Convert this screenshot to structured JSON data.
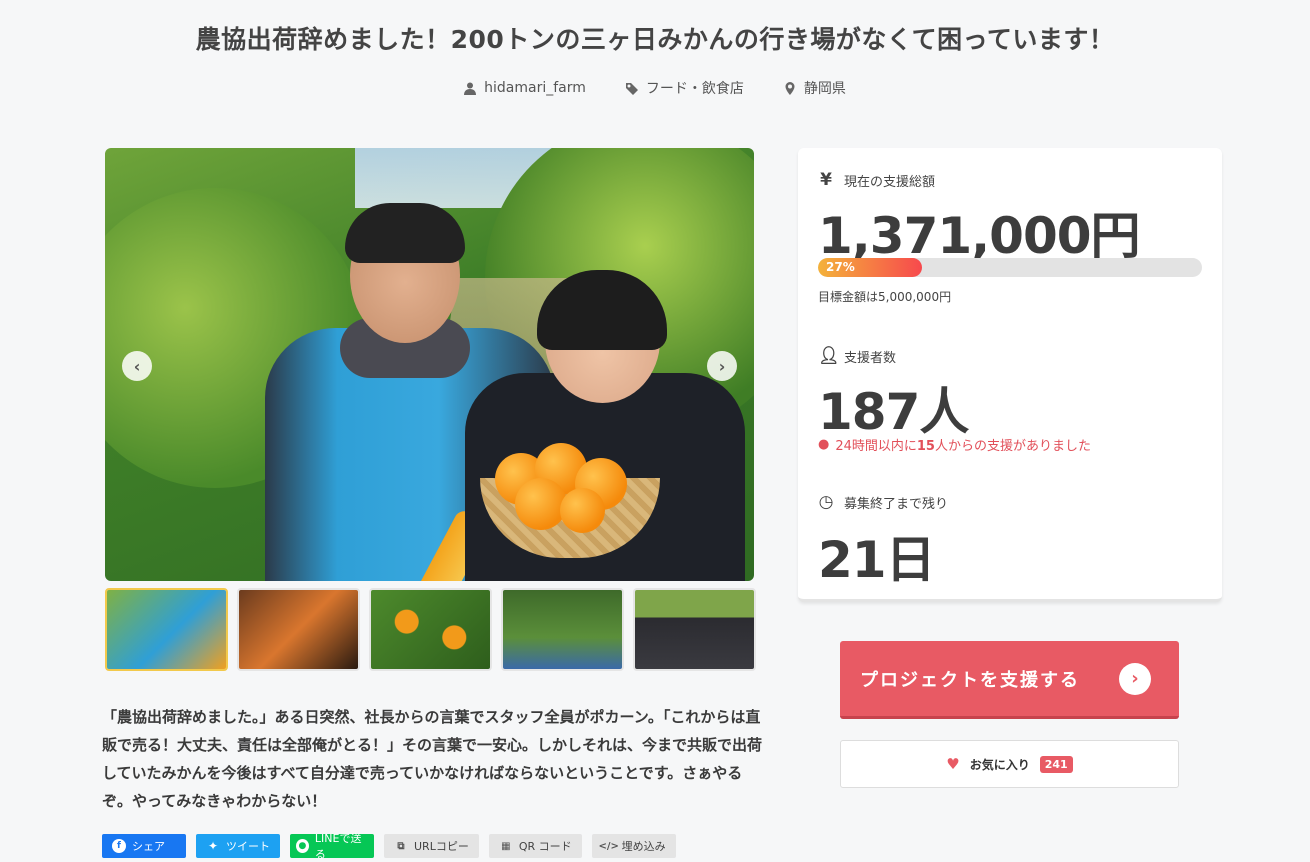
{
  "title": "農協出荷辞めました！200トンの三ヶ日みかんの行き場がなくて困っています！",
  "meta": {
    "author": "hidamari_farm",
    "category": "フード・飲食店",
    "location": "静岡県",
    "icons": [
      "user-icon",
      "tag-icon",
      "map-pin-icon"
    ]
  },
  "gallery": {
    "prev": "‹",
    "next": "›",
    "thumbnail_count": 5,
    "active_index": 0
  },
  "description": "「農協出荷辞めました。」ある日突然、社長からの言葉でスタッフ全員がポカーン。「これからは直販で売る！大丈夫、責任は全部俺がとる！」その言葉で一安心。しかしそれは、今まで共販で出荷していたみかんを今後はすべて自分達で売っていかなければならないということです。さぁやるぞ。やってみなきゃわからない！",
  "share": {
    "facebook": "シェア",
    "twitter": "ツイート",
    "line": "LINEで送る",
    "url": "URLコピー",
    "qr": "QR コード",
    "embed": "埋め込み"
  },
  "stats": {
    "amount_label": "現在の支援総額",
    "amount": "1,371,000円",
    "progress_text": "27%",
    "progress": 0.27,
    "goal": "目標金額は5,000,000円",
    "backers_label": "支援者数",
    "backers": "187人",
    "recent_pre": "24時間以内に",
    "recent_num": "15",
    "recent_post": "人からの支援がありました",
    "remaining_label": "募集終了まで残り",
    "remaining": "21日"
  },
  "actions": {
    "support": "プロジェクトを支援する",
    "favorite": "お気に入り",
    "favorite_count": "241"
  },
  "colors": {
    "accent": "#e85a64",
    "progress_start": "#f4b23a",
    "progress_end": "#f7494d"
  }
}
